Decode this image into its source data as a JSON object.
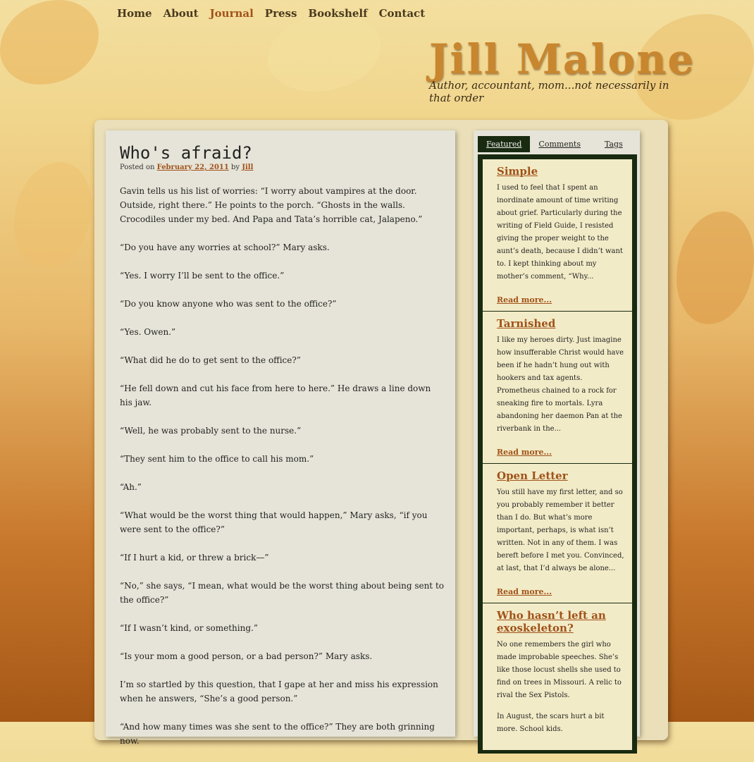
{
  "nav": {
    "items": [
      "Home",
      "About",
      "Journal",
      "Press",
      "Bookshelf",
      "Contact"
    ],
    "active": "Journal"
  },
  "site": {
    "title": "Jill Malone",
    "tagline": "Author, accountant, mom...not necessarily in that order"
  },
  "post": {
    "title": "Who's afraid?",
    "posted_on": "Posted on",
    "date": "February 22, 2011",
    "by": "by",
    "author": "Jill",
    "paragraphs": [
      "Gavin tells us his list of worries: “I worry about vampires at the door. Outside, right there.” He points to the porch. “Ghosts in the walls. Crocodiles under my bed. And Papa and Tata’s horrible cat, Jalapeno.”",
      "“Do you have any worries at school?” Mary asks.",
      "“Yes. I worry I’ll be sent to the office.”",
      "“Do you know anyone who was sent to the office?”",
      "“Yes. Owen.”",
      "“What did he do to get sent to the office?”",
      "“He fell down and cut his face from here to here.” He draws a line down his jaw.",
      "“Well, he was probably sent to the nurse.”",
      "“They sent him to the office to call his mom.”",
      "“Ah.”",
      "“What would be the worst thing that would happen,” Mary asks, “if you were sent to the office?”",
      "“If I hurt a kid, or threw a brick—”",
      "“No,” she says, “I mean, what would be the worst thing about being sent to the office?”",
      "“If I wasn’t kind, or something.”",
      "“Is your mom a good person, or a bad person?” Mary asks.",
      "I’m so startled by this question, that I gape at her and miss his expression when he answers, “She’s a good person.”",
      "“And how many times was she sent to the office?” They are both grinning now."
    ]
  },
  "sidebar": {
    "tabs": [
      "Featured",
      "Comments",
      "Tags"
    ],
    "active_tab": "Featured",
    "items": [
      {
        "title": "Simple",
        "excerpt": "I used to feel that I spent an inordinate amount of time writing about grief.  Particularly during the writing of Field Guide, I resisted giving the proper weight to the aunt’s death, because I didn’t want to.  I kept thinking about my mother’s comment, “Why...",
        "more": "Read more..."
      },
      {
        "title": "Tarnished",
        "excerpt": "I like my heroes dirty. Just imagine how insufferable Christ would have been if he hadn’t hung out with hookers and tax agents. Prometheus chained to a rock for sneaking fire to mortals. Lyra abandoning her daemon Pan at the riverbank in the...",
        "more": "Read more..."
      },
      {
        "title": "Open Letter",
        "excerpt": "You still have my first letter, and so you probably remember it better than I do. But what’s more important, perhaps, is what isn’t written. Not in any of them. I was bereft before I met you. Convinced, at last, that I’d always be alone...",
        "more": "Read more..."
      },
      {
        "title": "Who hasn’t left an exoskeleton?",
        "excerpt": "No one remembers the girl who made improbable speeches. She’s like those locust shells she used to find on trees in Missouri. A relic to rival the Sex Pistols.",
        "excerpt2": "In August, the scars hurt a bit more. School kids."
      }
    ]
  }
}
